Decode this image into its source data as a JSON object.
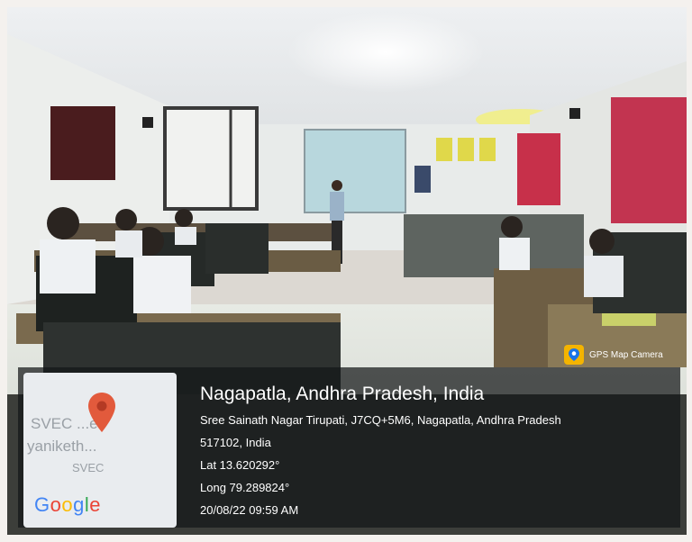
{
  "location": {
    "title": "Nagapatla, Andhra Pradesh, India",
    "address_line1": "Sree Sainath Nagar Tirupati, J7CQ+5M6, Nagapatla, Andhra Pradesh",
    "address_line2": "517102, India",
    "latitude": "Lat 13.620292°",
    "longitude": "Long 79.289824°",
    "timestamp": "20/08/22 09:59 AM"
  },
  "map": {
    "place_label_1": "SVEC ...ee",
    "place_label_2": "yaniketh...",
    "place_label_3": "SVEC",
    "logo_text": "Google",
    "pin_icon": "map-pin-icon"
  },
  "badge": {
    "label": "GPS Map Camera",
    "icon": "gps-camera-icon"
  }
}
